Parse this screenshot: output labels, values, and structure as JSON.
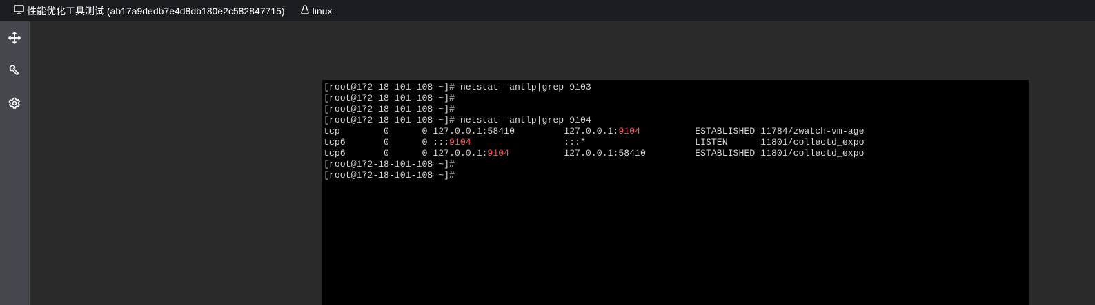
{
  "topbar": {
    "title": "性能优化工具测试 (ab17a9dedb7e4d8db180e2c582847715)",
    "title_icon": "monitor-icon",
    "os_label": "linux",
    "os_icon": "linux-penguin-icon"
  },
  "sidebar": {
    "items": [
      {
        "icon": "move-icon"
      },
      {
        "icon": "wrench-icon"
      },
      {
        "icon": "gear-icon"
      }
    ]
  },
  "colors": {
    "highlight": "#ff5555",
    "terminal_text": "#d8d8d8",
    "terminal_bg": "#000000"
  },
  "terminal": {
    "lines": [
      [
        {
          "t": "[root@172-18-101-108 ~]# netstat -antlp|grep 9103"
        }
      ],
      [
        {
          "t": "[root@172-18-101-108 ~]#"
        }
      ],
      [
        {
          "t": "[root@172-18-101-108 ~]#"
        }
      ],
      [
        {
          "t": "[root@172-18-101-108 ~]# netstat -antlp|grep 9104"
        }
      ],
      [
        {
          "t": "tcp        0      0 127.0.0.1:58410         127.0.0.1:"
        },
        {
          "t": "9104",
          "hl": true
        },
        {
          "t": "          ESTABLISHED 11784/zwatch-vm-age"
        }
      ],
      [
        {
          "t": "tcp6       0      0 :::"
        },
        {
          "t": "9104",
          "hl": true
        },
        {
          "t": "                 :::*                    LISTEN      11801/collectd_expo"
        }
      ],
      [
        {
          "t": "tcp6       0      0 127.0.0.1:"
        },
        {
          "t": "9104",
          "hl": true
        },
        {
          "t": "          127.0.0.1:58410         ESTABLISHED 11801/collectd_expo"
        }
      ],
      [
        {
          "t": "[root@172-18-101-108 ~]#"
        }
      ],
      [
        {
          "t": "[root@172-18-101-108 ~]#"
        }
      ]
    ]
  }
}
